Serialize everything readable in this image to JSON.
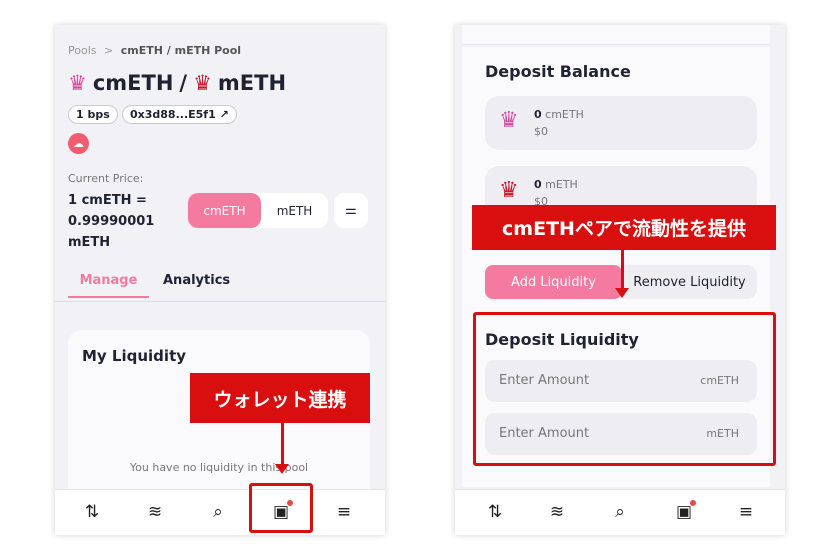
{
  "left": {
    "breadcrumb": {
      "root": "Pools",
      "sep": ">",
      "current": "cmETH / mETH Pool"
    },
    "title": {
      "token_a": "cmETH",
      "slash": "/",
      "token_b": "mETH"
    },
    "fee_badge": "1 bps",
    "address_badge": "0x3d88...E5f1",
    "current_price_label": "Current Price:",
    "price_lines": [
      "1 cmETH =",
      "0.99990001",
      "mETH"
    ],
    "toggle": [
      "cmETH",
      "mETH"
    ],
    "tabs": [
      "Manage",
      "Analytics"
    ],
    "card_title": "My Liquidity",
    "empty_text": "You have no liquidity in this pool",
    "annotation": "ウォレット連携"
  },
  "right": {
    "deposit_balance_title": "Deposit Balance",
    "balances": [
      {
        "amount": "0",
        "token": "cmETH",
        "usd": "$0"
      },
      {
        "amount": "0",
        "token": "mETH",
        "usd": "$0"
      }
    ],
    "annotation": "cmETHペアで流動性を提供",
    "tabs": [
      "Add Liquidity",
      "Remove Liquidity"
    ],
    "deposit_title": "Deposit Liquidity",
    "inputs": [
      {
        "placeholder": "Enter Amount",
        "token": "cmETH"
      },
      {
        "placeholder": "Enter Amount",
        "token": "mETH"
      }
    ]
  },
  "nav_icons": [
    "swap-icon",
    "pool-icon",
    "search-icon",
    "wallet-icon",
    "menu-icon"
  ],
  "colors": {
    "accent": "#f57aa0",
    "annotation": "#d90f0f"
  }
}
